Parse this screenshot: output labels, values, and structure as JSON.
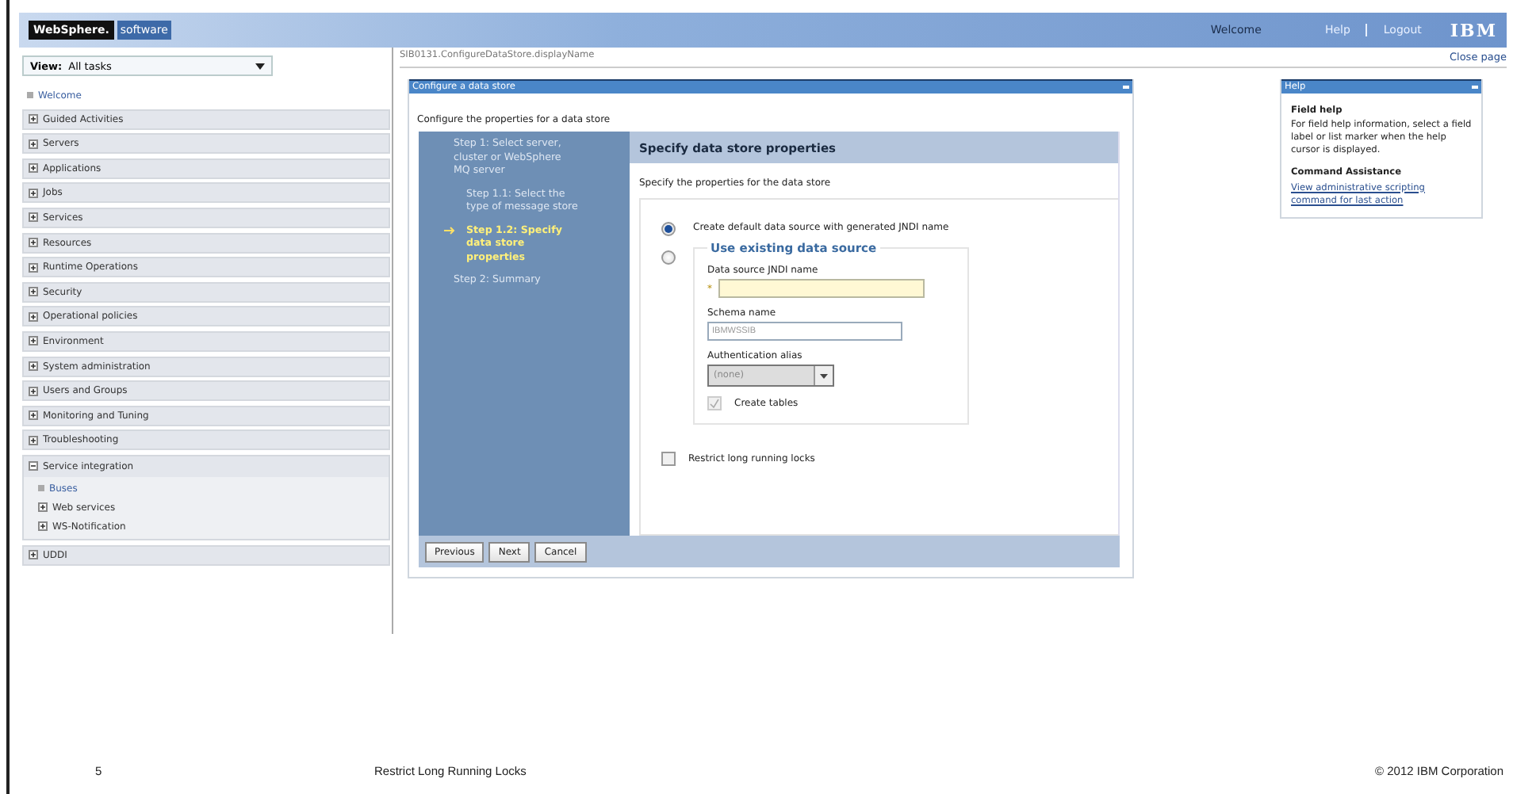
{
  "header": {
    "brand": "WebSphere.",
    "brand_sub": "software",
    "links": [
      {
        "label": "Welcome",
        "kind": "text"
      },
      {
        "label": "Help",
        "kind": "link"
      },
      {
        "label": "Logout",
        "kind": "link"
      }
    ],
    "logo": "IBM"
  },
  "nav": {
    "view_label": "View:",
    "view_value": "All tasks",
    "items": [
      {
        "label": "Welcome",
        "kind": "leaf"
      },
      {
        "label": "Guided Activities",
        "kind": "group",
        "expanded": false
      },
      {
        "label": "Servers",
        "kind": "group",
        "expanded": false
      },
      {
        "label": "Applications",
        "kind": "group",
        "expanded": false
      },
      {
        "label": "Jobs",
        "kind": "group",
        "expanded": false
      },
      {
        "label": "Services",
        "kind": "group",
        "expanded": false
      },
      {
        "label": "Resources",
        "kind": "group",
        "expanded": false
      },
      {
        "label": "Runtime Operations",
        "kind": "group",
        "expanded": false
      },
      {
        "label": "Security",
        "kind": "group",
        "expanded": false
      },
      {
        "label": "Operational policies",
        "kind": "group",
        "expanded": false
      },
      {
        "label": "Environment",
        "kind": "group",
        "expanded": false
      },
      {
        "label": "System administration",
        "kind": "group",
        "expanded": false
      },
      {
        "label": "Users and Groups",
        "kind": "group",
        "expanded": false
      },
      {
        "label": "Monitoring and Tuning",
        "kind": "group",
        "expanded": false
      },
      {
        "label": "Troubleshooting",
        "kind": "group",
        "expanded": false
      },
      {
        "label": "Service integration",
        "kind": "group",
        "expanded": true,
        "children": [
          {
            "label": "Buses",
            "kind": "leaf"
          },
          {
            "label": "Web services",
            "kind": "group",
            "expanded": false
          },
          {
            "label": "WS-Notification",
            "kind": "group",
            "expanded": false
          }
        ]
      },
      {
        "label": "UDDI",
        "kind": "group",
        "expanded": false
      }
    ]
  },
  "content": {
    "breadcrumb": "SIB0131.ConfigureDataStore.displayName",
    "close_link": "Close page",
    "panel_title": "Configure a data store",
    "intro": "Configure the properties for a data store",
    "steps": [
      {
        "label": "Step  1:  Select server, cluster or WebSphere MQ server",
        "selected": false,
        "children": [
          {
            "label": "Step  1.1:  Select the type of message store",
            "selected": false
          },
          {
            "label": "Step  1.2: Specify data store properties",
            "selected": true
          }
        ]
      },
      {
        "label": "Step  2:  Summary",
        "selected": false
      }
    ],
    "form": {
      "title": "Specify data store properties",
      "description": "Specify the properties for the data store",
      "options": [
        {
          "label": "Create default data source with generated JNDI name",
          "selected": true
        },
        {
          "label": "Use existing data source",
          "selected": false
        }
      ],
      "jndi": {
        "label": "Data source JNDI name",
        "required_mark": "*"
      },
      "schema": {
        "label": "Schema name",
        "value": "IBMWSSIB",
        "disabled": true
      },
      "auth": {
        "label": "Authentication alias",
        "value": "(none)",
        "disabled": true
      },
      "create_tables": {
        "label": "Create tables",
        "checked": true,
        "disabled": true
      },
      "restrict": {
        "label": "Restrict long running locks",
        "checked": false
      }
    },
    "buttons": [
      "Previous",
      "Next",
      "Cancel"
    ]
  },
  "help": {
    "title": "Help",
    "field_help_title": "Field help",
    "field_help_text": "For field help information, select a field label or list marker when the help cursor is displayed.",
    "command_title": "Command Assistance",
    "command_link": "View administrative scripting command for last action"
  },
  "footer": {
    "page_number": "5",
    "title": "Restrict Long Running Locks",
    "copyright": "© 2012 IBM Corporation"
  }
}
